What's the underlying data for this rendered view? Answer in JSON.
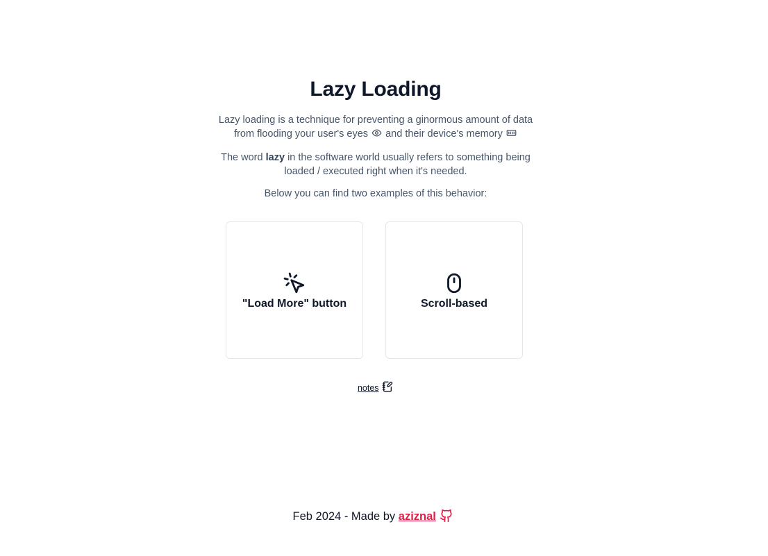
{
  "title": "Lazy Loading",
  "intro": {
    "p1_before": "Lazy loading is a technique for preventing a ginormous amount of data from flooding your user's eyes",
    "p1_middle": "and their device's memory",
    "p2_before": "The word",
    "p2_bold": "lazy",
    "p2_after": "in the software world usually refers to something being loaded / executed right when it's needed.",
    "p3": "Below you can find two examples of this behavior:"
  },
  "cards": [
    {
      "label": "\"Load More\" button",
      "icon": "pointer-click-icon"
    },
    {
      "label": "Scroll-based",
      "icon": "mouse-icon"
    }
  ],
  "notes": {
    "label": "notes",
    "icon": "edit-note-icon"
  },
  "footer": {
    "text": "Feb 2024 - Made by",
    "author": "aziznal",
    "icon": "github-icon",
    "accent": "#e11d48"
  }
}
